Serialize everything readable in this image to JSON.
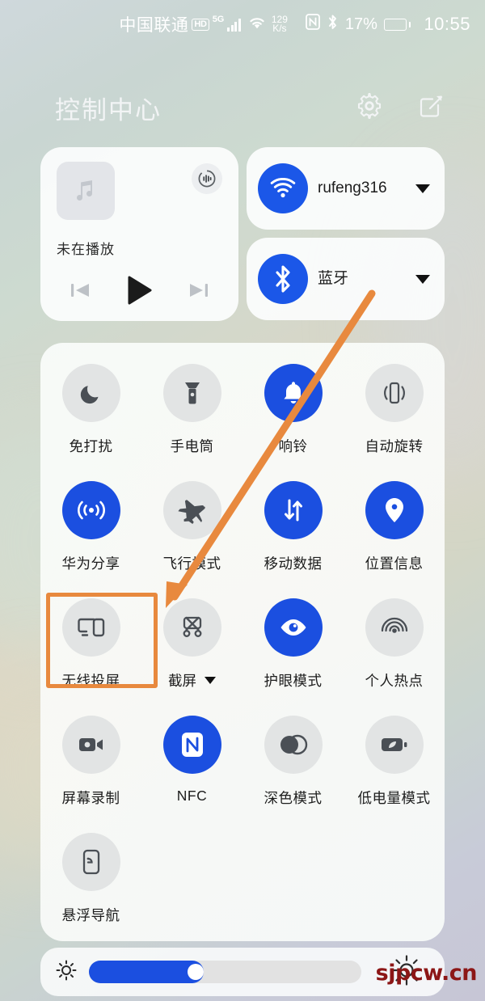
{
  "status_bar": {
    "carrier": "中国联通",
    "hd_badge": "HD",
    "network_type": "5G",
    "data_speed_value": "129",
    "data_speed_unit": "K/s",
    "nfc_icon": "nfc-icon",
    "bluetooth_icon": "bluetooth-icon",
    "battery_percent": "17%",
    "battery_level": 17,
    "time": "10:55"
  },
  "header": {
    "title": "控制中心",
    "settings_icon": "gear-icon",
    "edit_icon": "edit-icon"
  },
  "media_card": {
    "thumb_icon": "music-note-icon",
    "output_icon": "audio-output-icon",
    "status_text": "未在播放",
    "prev_icon": "previous-track-icon",
    "play_icon": "play-icon",
    "next_icon": "next-track-icon"
  },
  "connectivity": [
    {
      "name": "wifi",
      "icon": "wifi-icon",
      "label": "rufeng316",
      "active": true,
      "expand_icon": "chevron-down-icon"
    },
    {
      "name": "bluetooth",
      "icon": "bluetooth-icon",
      "label": "蓝牙",
      "active": true,
      "expand_icon": "chevron-down-icon"
    }
  ],
  "toggles": [
    {
      "label": "免打扰",
      "icon": "moon-icon",
      "active": false,
      "has_dropdown": false
    },
    {
      "label": "手电筒",
      "icon": "flashlight-icon",
      "active": false,
      "has_dropdown": false
    },
    {
      "label": "响铃",
      "icon": "bell-icon",
      "active": true,
      "has_dropdown": false
    },
    {
      "label": "自动旋转",
      "icon": "auto-rotate-icon",
      "active": false,
      "has_dropdown": false
    },
    {
      "label": "华为分享",
      "icon": "huawei-share-icon",
      "active": true,
      "has_dropdown": false
    },
    {
      "label": "飞行模式",
      "icon": "airplane-icon",
      "active": false,
      "has_dropdown": false
    },
    {
      "label": "移动数据",
      "icon": "mobile-data-icon",
      "active": true,
      "has_dropdown": false
    },
    {
      "label": "位置信息",
      "icon": "location-pin-icon",
      "active": true,
      "has_dropdown": false
    },
    {
      "label": "无线投屏",
      "icon": "screen-cast-icon",
      "active": false,
      "has_dropdown": false,
      "highlighted": true
    },
    {
      "label": "截屏",
      "icon": "screenshot-icon",
      "active": false,
      "has_dropdown": true
    },
    {
      "label": "护眼模式",
      "icon": "eye-comfort-icon",
      "active": true,
      "has_dropdown": false
    },
    {
      "label": "个人热点",
      "icon": "hotspot-icon",
      "active": false,
      "has_dropdown": false
    },
    {
      "label": "屏幕录制",
      "icon": "screen-record-icon",
      "active": false,
      "has_dropdown": false
    },
    {
      "label": "NFC",
      "icon": "nfc-icon",
      "active": true,
      "has_dropdown": false
    },
    {
      "label": "深色模式",
      "icon": "dark-mode-icon",
      "active": false,
      "has_dropdown": false
    },
    {
      "label": "低电量模式",
      "icon": "battery-saver-icon",
      "active": false,
      "has_dropdown": false
    },
    {
      "label": "悬浮导航",
      "icon": "floating-nav-icon",
      "active": false,
      "has_dropdown": false
    }
  ],
  "brightness": {
    "low_icon": "brightness-low-icon",
    "high_icon": "brightness-high-icon",
    "value_percent": 42
  },
  "annotation": {
    "highlight_color": "#e8893e",
    "arrow_color": "#e8893e",
    "highlight_target": "无线投屏"
  },
  "watermark": {
    "text": "sjpcw.cn",
    "color": "#8c1616"
  },
  "colors": {
    "accent_on": "#1b4fe0",
    "tile_off": "#e2e4e4",
    "panel": "#fbfdfc"
  }
}
